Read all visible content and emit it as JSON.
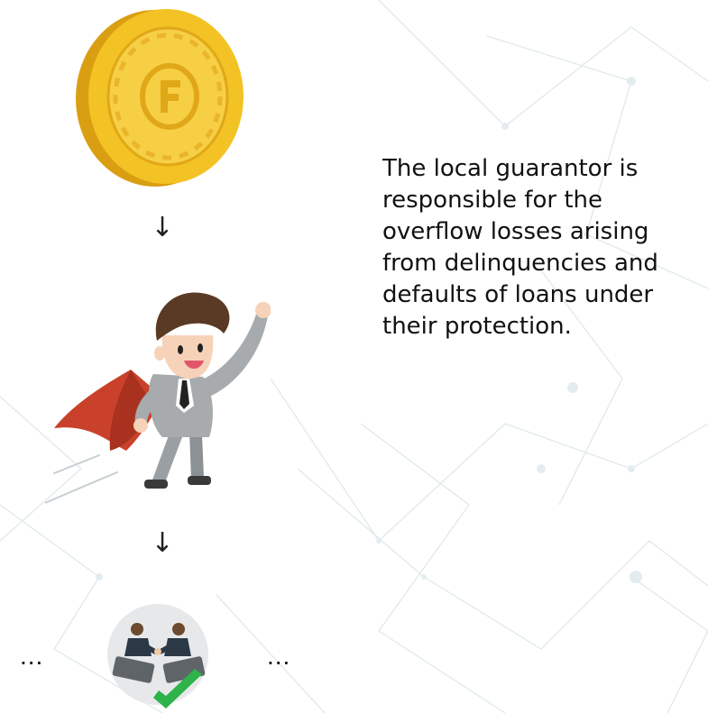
{
  "description": "The local guarantor is responsible for the overflow losses arising from delinquencies and defaults of loans under their protection.",
  "flow": {
    "arrow_1": "↓",
    "arrow_2": "↓",
    "ellipsis_left": "...",
    "ellipsis_right": "..."
  },
  "icons": {
    "coin": "gold-coin-icon",
    "guarantor": "flying-businessman-superhero-icon",
    "deal": "handshake-deal-icon",
    "approved": "green-checkmark-icon"
  },
  "colors": {
    "coin_gold": "#F3C224",
    "coin_dark": "#D99E12",
    "cape_red": "#C9412A",
    "suit_gray": "#A7ABAE",
    "check_green": "#2DB34A",
    "network_lines": "#D9E6EA"
  }
}
